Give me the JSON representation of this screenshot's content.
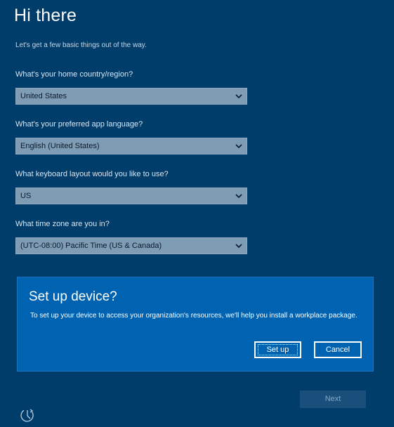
{
  "page": {
    "title": "Hi there",
    "subtitle": "Let's get a few basic things out of the way."
  },
  "form": {
    "country": {
      "label": "What's your home country/region?",
      "value": "United States"
    },
    "language": {
      "label": "What's your preferred app language?",
      "value": "English (United States)"
    },
    "keyboard": {
      "label": "What keyboard layout would you like to use?",
      "value": "US"
    },
    "timezone": {
      "label": "What time zone are you in?",
      "value": "(UTC-08:00) Pacific Time (US & Canada)"
    }
  },
  "dialog": {
    "title": "Set up device?",
    "body": "To set up your device to access your organization's resources, we'll help you install a workplace package.",
    "setup_label": "Set up",
    "cancel_label": "Cancel"
  },
  "footer": {
    "next_label": "Next",
    "ease_icon": "ease-of-access-icon"
  },
  "colors": {
    "background": "#003d6b",
    "dialog": "#0063b1",
    "select": "#7f9cb5"
  }
}
